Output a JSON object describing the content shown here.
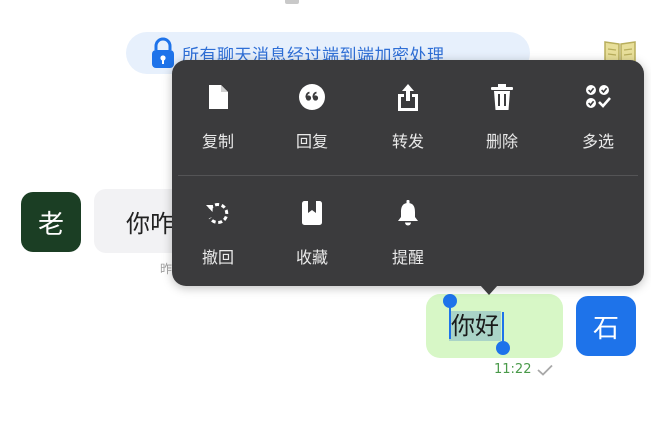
{
  "notice": {
    "text": "所有聊天消息经过端到端加密处理"
  },
  "contact": {
    "avatar_char": "老"
  },
  "me": {
    "avatar_char": "石"
  },
  "messages": {
    "incoming_text": "你咋",
    "incoming_time": "昨",
    "outgoing_text": "你好",
    "outgoing_time": "11:22"
  },
  "menu": {
    "row1": [
      {
        "label": "复制",
        "icon": "copy-icon"
      },
      {
        "label": "回复",
        "icon": "reply-quote-icon"
      },
      {
        "label": "转发",
        "icon": "forward-share-icon"
      },
      {
        "label": "删除",
        "icon": "trash-icon"
      },
      {
        "label": "多选",
        "icon": "multi-select-icon"
      }
    ],
    "row2": [
      {
        "label": "撤回",
        "icon": "recall-icon"
      },
      {
        "label": "收藏",
        "icon": "bookmark-icon"
      },
      {
        "label": "提醒",
        "icon": "bell-icon"
      }
    ]
  },
  "colors": {
    "menu_bg": "#3b3b3d",
    "accent_blue": "#1e73ea",
    "outgoing_bubble": "#d7f7c6",
    "notice_bg": "#e7f0fc"
  }
}
